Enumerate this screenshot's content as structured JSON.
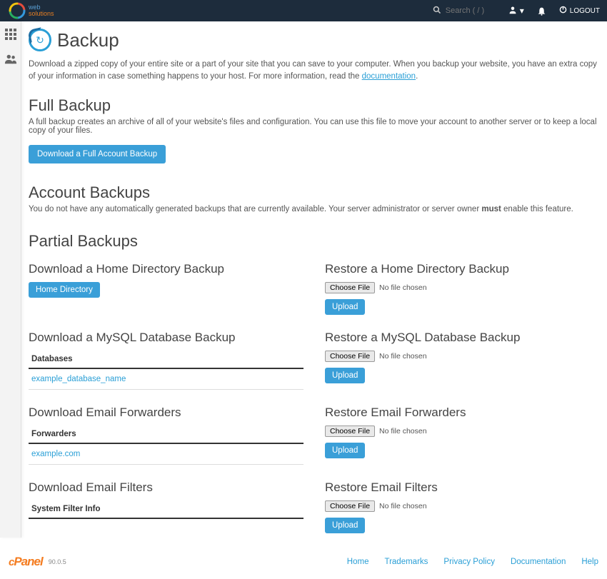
{
  "header": {
    "search_placeholder": "Search ( / )",
    "logout": "LOGOUT"
  },
  "page": {
    "title": "Backup",
    "intro_1": "Download a zipped copy of your entire site or a part of your site that you can save to your computer. When you backup your website, you have an extra copy of your information in case something happens to your host. For more information, read the ",
    "intro_link": "documentation",
    "intro_2": "."
  },
  "full": {
    "heading": "Full Backup",
    "desc": "A full backup creates an archive of all of your website's files and configuration. You can use this file to move your account to another server or to keep a local copy of your files.",
    "button": "Download a Full Account Backup"
  },
  "account": {
    "heading": "Account Backups",
    "desc_1": "You do not have any automatically generated backups that are currently available. Your server administrator or server owner ",
    "desc_strong": "must",
    "desc_2": " enable this feature."
  },
  "partial": {
    "heading": "Partial Backups",
    "home": {
      "download_h": "Download a Home Directory Backup",
      "download_btn": "Home Directory",
      "restore_h": "Restore a Home Directory Backup"
    },
    "mysql": {
      "download_h": "Download a MySQL Database Backup",
      "tbl_header": "Databases",
      "db_name": "example_database_name",
      "restore_h": "Restore a MySQL Database Backup"
    },
    "fwd": {
      "download_h": "Download Email Forwarders",
      "tbl_header": "Forwarders",
      "domain": "example.com",
      "restore_h": "Restore Email Forwarders"
    },
    "filters": {
      "download_h": "Download Email Filters",
      "tbl_header": "System Filter Info",
      "restore_h": "Restore Email Filters"
    },
    "choose_file": "Choose File",
    "no_file": "No file chosen",
    "upload": "Upload"
  },
  "footer": {
    "brand": "cPanel",
    "version": "90.0.5",
    "links": {
      "home": "Home",
      "trademarks": "Trademarks",
      "privacy": "Privacy Policy",
      "docs": "Documentation",
      "help": "Help"
    }
  }
}
